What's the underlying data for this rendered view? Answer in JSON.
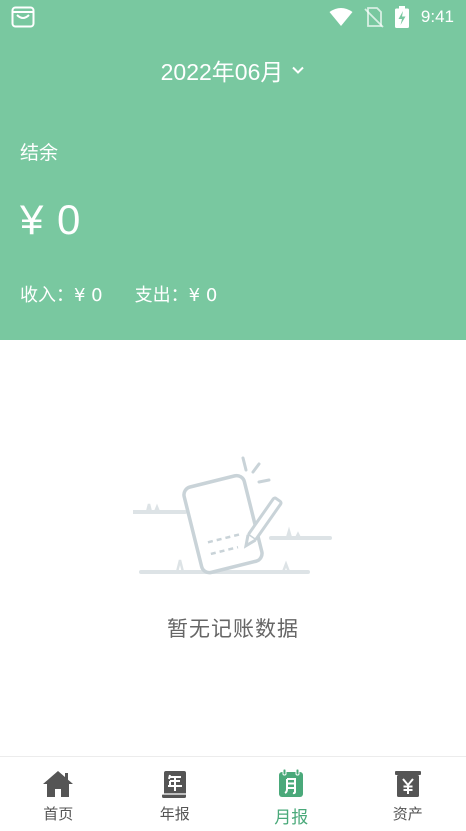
{
  "status_bar": {
    "time": "9:41",
    "icons": [
      "app-notification-icon",
      "wifi-icon",
      "no-sim-icon",
      "battery-charging-icon"
    ]
  },
  "header": {
    "month": "2022年06月",
    "balance_label": "结余",
    "balance_amount": "¥ 0",
    "income": "收入：¥ 0",
    "expense": "支出：¥ 0"
  },
  "empty_state": {
    "message": "暂无记账数据",
    "icon": "empty-notebook-illustration"
  },
  "tabs": [
    {
      "label": "首页",
      "icon": "home-icon",
      "active": false
    },
    {
      "label": "年报",
      "icon": "year-report-icon",
      "active": false
    },
    {
      "label": "月报",
      "icon": "month-report-icon",
      "active": true
    },
    {
      "label": "资产",
      "icon": "assets-icon",
      "active": false
    }
  ],
  "colors": {
    "header_bg": "#79c8a0",
    "accent": "#4aa97a",
    "tab_inactive": "#555555"
  }
}
